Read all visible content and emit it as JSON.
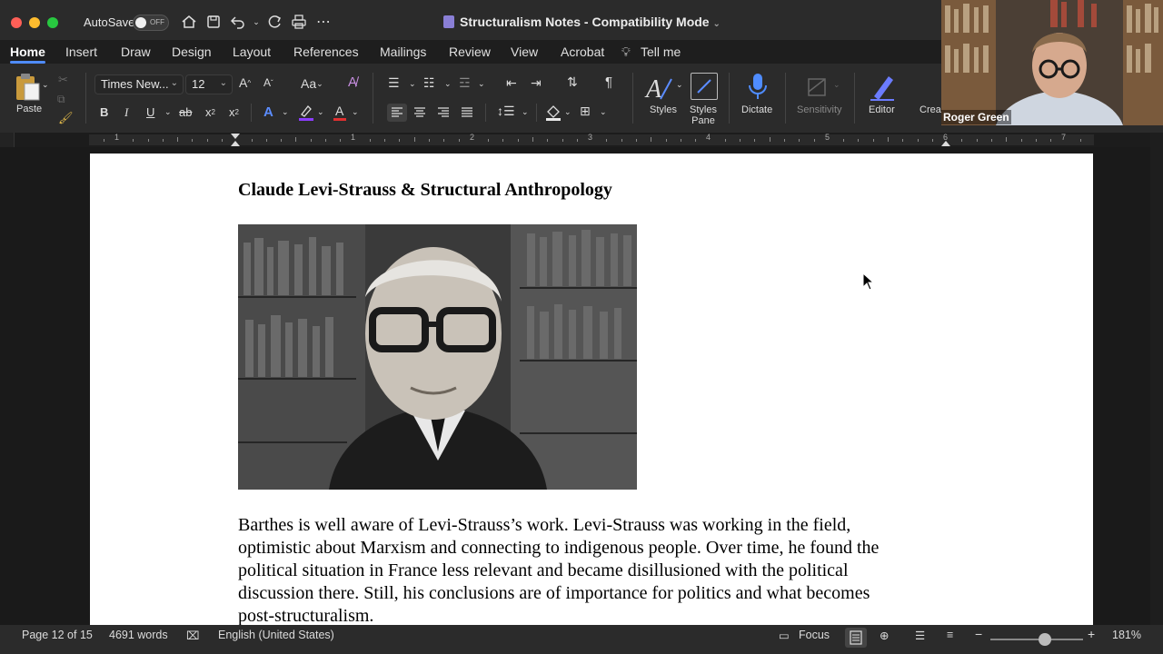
{
  "window": {
    "autosave_label": "AutoSave",
    "autosave_state": "OFF",
    "title": "Structuralism Notes  -  Compatibility Mode"
  },
  "tabs": [
    {
      "label": "Home",
      "active": true
    },
    {
      "label": "Insert"
    },
    {
      "label": "Draw"
    },
    {
      "label": "Design"
    },
    {
      "label": "Layout"
    },
    {
      "label": "References"
    },
    {
      "label": "Mailings"
    },
    {
      "label": "Review"
    },
    {
      "label": "View"
    },
    {
      "label": "Acrobat"
    },
    {
      "label": "Tell me"
    }
  ],
  "ribbon": {
    "paste_label": "Paste",
    "font_name": "Times New...",
    "font_size": "12",
    "styles_label": "Styles",
    "styles_pane_label_1": "Styles",
    "styles_pane_label_2": "Pane",
    "dictate_label": "Dictate",
    "sensitivity_label": "Sensitivity",
    "editor_label": "Editor",
    "create_label": "Crea"
  },
  "ruler": {
    "numbers": [
      "1",
      "1",
      "2",
      "3",
      "4",
      "5",
      "6",
      "7"
    ]
  },
  "document": {
    "heading": "Claude Levi-Strauss & Structural Anthropology",
    "body_lines": [
      "Barthes is well aware of Levi-Strauss’s work.  Levi-Strauss was working in the field,",
      "optimistic about Marxism and connecting to indigenous people.  Over time, he found the",
      "political situation in France less relevant and became disillusioned with the political",
      "discussion there.  Still, his conclusions are of importance for politics and what becomes",
      "post-structuralism."
    ]
  },
  "status": {
    "page": "Page 12 of 15",
    "words": "4691 words",
    "language": "English (United States)",
    "focus": "Focus",
    "zoom": "181%"
  },
  "video": {
    "participant_name": "Roger Green"
  },
  "colors": {
    "accent": "#4f8cff",
    "dictate": "#4f8cff",
    "editor": "#6b7cff"
  }
}
